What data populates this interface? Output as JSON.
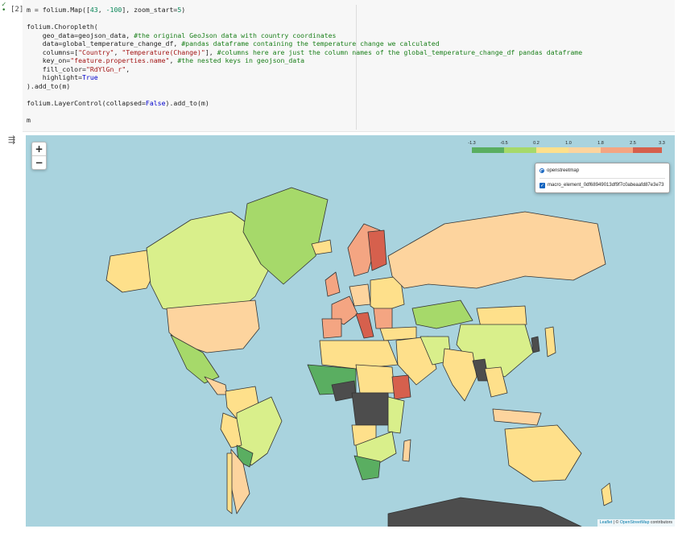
{
  "cell": {
    "prompt": "[2]",
    "exec_status": "executed",
    "code": {
      "l1_a": "m = folium.Map([",
      "l1_n1": "43",
      "l1_b": ", ",
      "l1_n2": "-100",
      "l1_c": "], zoom_start=",
      "l1_n3": "5",
      "l1_d": ")",
      "l2": "folium.Choropleth(",
      "l3_a": "    geo_data=geojson_data, ",
      "l3_c": "#the original GeoJson data with country coordinates",
      "l4_a": "    data=global_temperature_change_df, ",
      "l4_c": "#pandas dataframe containing the temperature change we calculated",
      "l5_a": "    columns=[",
      "l5_s1": "\"Country\"",
      "l5_b": ", ",
      "l5_s2": "\"Temperature(Change)\"",
      "l5_c1": "], ",
      "l5_c": "#columns here are just the column names of the global_temperature_change_df pandas dataframe",
      "l6_a": "    key_on=",
      "l6_s": "\"feature.properties.name\"",
      "l6_b": ", ",
      "l6_c": "#the nested keys in geojson_data",
      "l7_a": "    fill_color=",
      "l7_s": "\"RdYlGn_r\"",
      "l7_b": ",",
      "l8_a": "    highlight=",
      "l8_k": "True",
      "l9": ").add_to(m)",
      "l10_a": "folium.LayerControl(collapsed=",
      "l10_k": "False",
      "l10_b": ").add_to(m)",
      "l11": "m"
    }
  },
  "output": {
    "icon": "output-collapse-icon",
    "zoom_in_label": "+",
    "zoom_out_label": "−",
    "legend": {
      "ticks": [
        "-1.3",
        "-0.5",
        "0.2",
        "1.0",
        "1.8",
        "2.5",
        "3.3"
      ],
      "colors": [
        "#5aae61",
        "#a6d96a",
        "#fee08b",
        "#fdd49e",
        "#f4a582",
        "#d6604d"
      ]
    },
    "layer_control": {
      "base_layer": "openstreetmap",
      "overlay": "macro_element_0df68949013df9f7c0abeaafd87e3e73"
    },
    "attribution": {
      "leaflet": "Leaflet",
      "sep": " | © ",
      "osm": "OpenStreetMap",
      "tail": " contributors"
    },
    "colors": {
      "ocean": "#a9d3de",
      "no_data": "#4d4d4d",
      "land_light": "#f2efe6"
    }
  }
}
